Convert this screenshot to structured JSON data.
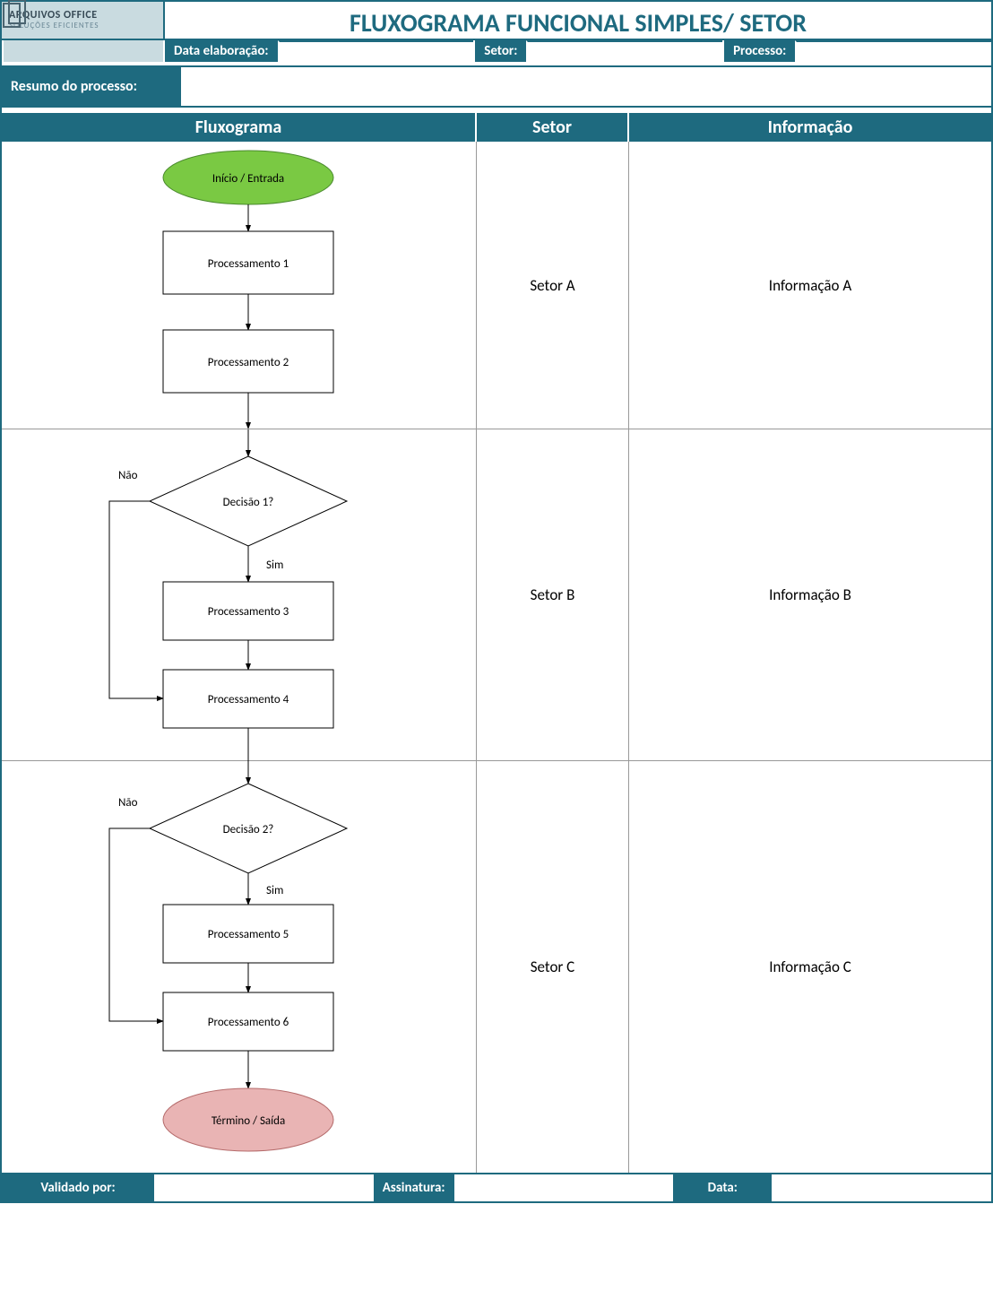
{
  "logo": {
    "line1": "ARQUIVOS OFFICE",
    "line2": "SOLUÇÕES EFICIENTES"
  },
  "title": "FLUXOGRAMA FUNCIONAL SIMPLES/ SETOR",
  "meta": {
    "data_label": "Data elaboração:",
    "data_value": "",
    "setor_label": "Setor:",
    "setor_value": "",
    "processo_label": "Processo:",
    "processo_value": ""
  },
  "resumo": {
    "label": "Resumo do processo:",
    "value": ""
  },
  "columns": {
    "flux": "Fluxograma",
    "setor": "Setor",
    "info": "Informação"
  },
  "lanes": [
    {
      "setor": "Setor A",
      "info": "Informação A"
    },
    {
      "setor": "Setor B",
      "info": "Informação B"
    },
    {
      "setor": "Setor C",
      "info": "Informação C"
    }
  ],
  "shapes": {
    "start": "Início / Entrada",
    "end": "Término / Saída",
    "proc1": "Processamento 1",
    "proc2": "Processamento 2",
    "proc3": "Processamento 3",
    "proc4": "Processamento 4",
    "proc5": "Processamento 5",
    "proc6": "Processamento 6",
    "dec1": "Decisão 1?",
    "dec2": "Decisão 2?",
    "yes": "Sim",
    "no": "Não"
  },
  "footer": {
    "validado_label": "Validado por:",
    "validado_value": "",
    "assinatura_label": "Assinatura:",
    "assinatura_value": "",
    "data_label": "Data:",
    "data_value": ""
  },
  "chart_data": {
    "type": "flowchart",
    "title": "Fluxograma Funcional Simples / Setor",
    "nodes": [
      {
        "id": "start",
        "type": "terminator",
        "label": "Início / Entrada",
        "lane": "Setor A"
      },
      {
        "id": "p1",
        "type": "process",
        "label": "Processamento 1",
        "lane": "Setor A"
      },
      {
        "id": "p2",
        "type": "process",
        "label": "Processamento 2",
        "lane": "Setor A"
      },
      {
        "id": "d1",
        "type": "decision",
        "label": "Decisão 1?",
        "lane": "Setor B"
      },
      {
        "id": "p3",
        "type": "process",
        "label": "Processamento 3",
        "lane": "Setor B"
      },
      {
        "id": "p4",
        "type": "process",
        "label": "Processamento 4",
        "lane": "Setor B"
      },
      {
        "id": "d2",
        "type": "decision",
        "label": "Decisão 2?",
        "lane": "Setor C"
      },
      {
        "id": "p5",
        "type": "process",
        "label": "Processamento 5",
        "lane": "Setor C"
      },
      {
        "id": "p6",
        "type": "process",
        "label": "Processamento 6",
        "lane": "Setor C"
      },
      {
        "id": "end",
        "type": "terminator",
        "label": "Término / Saída",
        "lane": "Setor C"
      }
    ],
    "edges": [
      {
        "from": "start",
        "to": "p1"
      },
      {
        "from": "p1",
        "to": "p2"
      },
      {
        "from": "p2",
        "to": "d1"
      },
      {
        "from": "d1",
        "to": "p3",
        "label": "Sim"
      },
      {
        "from": "d1",
        "to": "p4",
        "label": "Não"
      },
      {
        "from": "p3",
        "to": "p4"
      },
      {
        "from": "p4",
        "to": "d2"
      },
      {
        "from": "d2",
        "to": "p5",
        "label": "Sim"
      },
      {
        "from": "d2",
        "to": "p6",
        "label": "Não"
      },
      {
        "from": "p5",
        "to": "p6"
      },
      {
        "from": "p6",
        "to": "end"
      }
    ],
    "lanes": [
      {
        "name": "Setor A",
        "info": "Informação A"
      },
      {
        "name": "Setor B",
        "info": "Informação B"
      },
      {
        "name": "Setor C",
        "info": "Informação C"
      }
    ]
  }
}
